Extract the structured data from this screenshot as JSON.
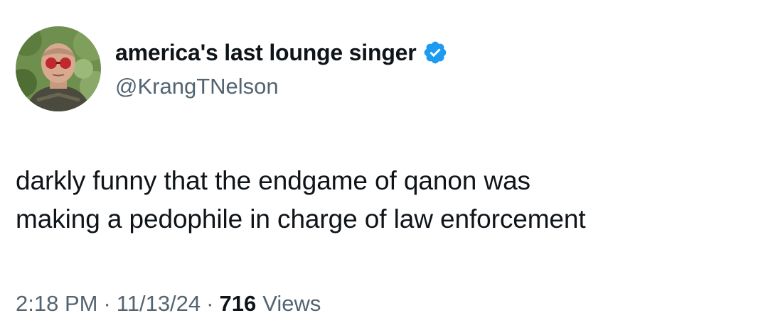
{
  "author": {
    "display_name": "america's last lounge singer",
    "handle": "@KrangTNelson",
    "verified": true,
    "avatar_icon": "profile-photo",
    "verified_icon": "verified-badge-icon",
    "verified_color": "#1d9bf0"
  },
  "tweet": {
    "lines": [
      "darkly funny that the endgame of qanon was",
      "making a pedophile in charge of law enforcement"
    ]
  },
  "meta": {
    "time": "2:18 PM",
    "separator": "·",
    "date": "11/13/24",
    "views_count": "716",
    "views_label": "Views"
  },
  "colors": {
    "text_primary": "#0f1419",
    "text_secondary": "#536471",
    "background": "#ffffff"
  }
}
